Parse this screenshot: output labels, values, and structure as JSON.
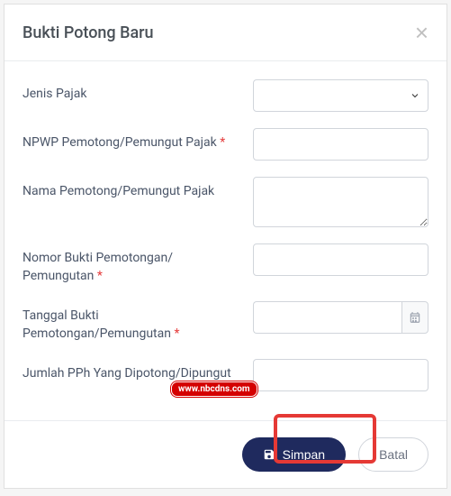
{
  "modal": {
    "title": "Bukti Potong Baru"
  },
  "fields": {
    "jenisPajak": {
      "label": "Jenis Pajak"
    },
    "npwp": {
      "label": "NPWP Pemotong/Pemungut Pajak ",
      "requiredMark": "*"
    },
    "nama": {
      "label": "Nama Pemotong/Pemungut Pajak"
    },
    "nomorBukti": {
      "label": "Nomor Bukti Pemotongan/ Pemungutan ",
      "requiredMark": "*"
    },
    "tanggalBukti": {
      "label": "Tanggal Bukti Pemotongan/Pemungutan ",
      "requiredMark": "*"
    },
    "jumlahPph": {
      "label": "Jumlah PPh Yang Dipotong/Dipungut"
    }
  },
  "footer": {
    "save": "Simpan",
    "cancel": "Batal"
  },
  "watermark": "www.nbcdns.com"
}
